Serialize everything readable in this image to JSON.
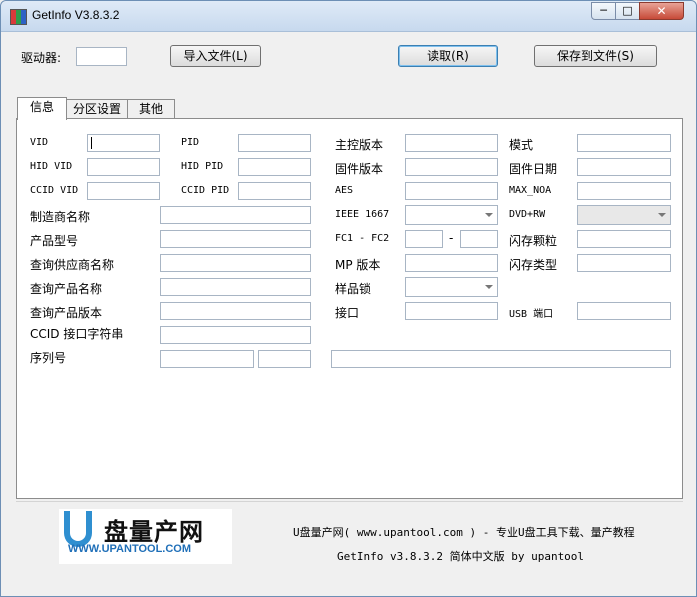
{
  "window": {
    "title": "GetInfo V3.8.3.2",
    "min_glyph": "─",
    "max_glyph": "□",
    "close_glyph": "✕"
  },
  "toolbar": {
    "drive_label": "驱动器:",
    "import_label": "导入文件(L)",
    "read_label": "读取(R)",
    "save_label": "保存到文件(S)"
  },
  "tabs": [
    "信息",
    "分区设置",
    "其他"
  ],
  "labels": {
    "vid": "VID",
    "pid": "PID",
    "controller_ver": "主控版本",
    "mode": "模式",
    "hid_vid": "HID VID",
    "hid_pid": "HID PID",
    "firmware_ver": "固件版本",
    "firmware_date": "固件日期",
    "ccid_vid": "CCID VID",
    "ccid_pid": "CCID PID",
    "aes": "AES",
    "max_noa": "MAX_NOA",
    "manufacturer": "制造商名称",
    "ieee": "IEEE 1667",
    "dvd_rw": "DVD+RW",
    "product_model": "产品型号",
    "fc": "FC1 - FC2",
    "fc_dash": "-",
    "flash_chip": "闪存颗粒",
    "vendor_query": "查询供应商名称",
    "mp_ver": "MP 版本",
    "flash_type": "闪存类型",
    "product_query": "查询产品名称",
    "sample_lock": "样品锁",
    "product_ver_query": "查询产品版本",
    "interface": "接口",
    "usb_port": "USB 端口",
    "ccid_string": "CCID 接口字符串",
    "serial": "序列号"
  },
  "footer": {
    "logo_text": "盘量产网",
    "logo_url": "WWW.UPANTOOL.COM",
    "line1": "U盘量产网( www.upantool.com ) - 专业U盘工具下载、量产教程",
    "line2": "GetInfo v3.8.3.2 简体中文版 by upantool"
  },
  "colors": {
    "accent": "#2f8fd0",
    "close": "#c74a38"
  }
}
